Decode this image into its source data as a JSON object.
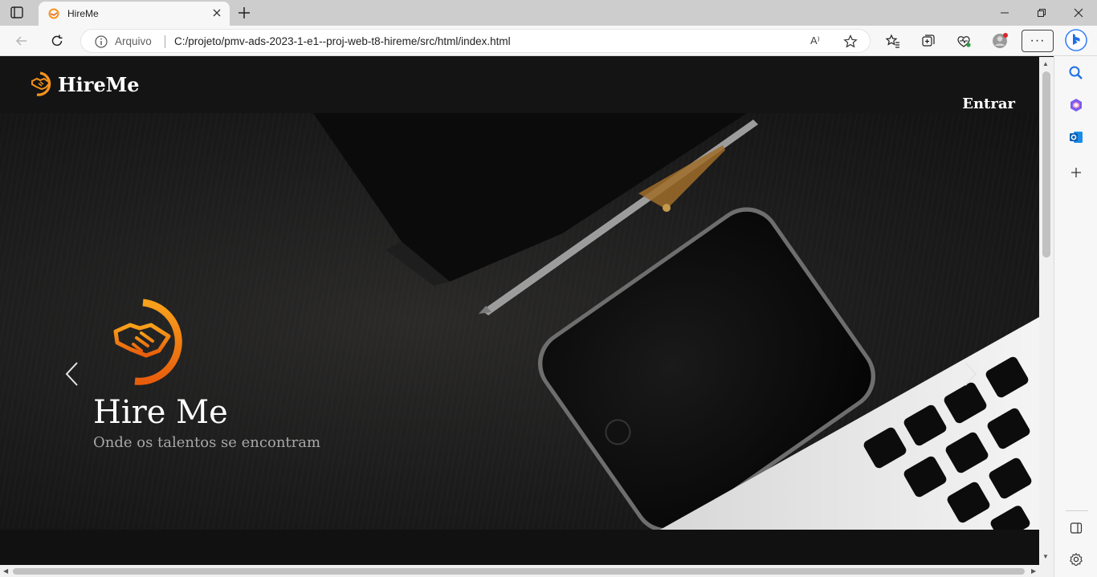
{
  "browser": {
    "tab": {
      "title": "HireMe"
    },
    "address": {
      "scheme_label": "Arquivo",
      "url": "C:/projeto/pmv-ads-2023-1-e1--proj-web-t8-hireme/src/html/index.html",
      "read_aloud": "A⁾"
    },
    "menu_label": "···"
  },
  "page": {
    "brand": "HireMe",
    "login_label": "Entrar",
    "hero": {
      "title": "Hire Me",
      "subtitle": "Onde os talentos se encontram"
    }
  },
  "colors": {
    "accent": "#f7931e",
    "accent_dark": "#e8650f",
    "page_bg": "#141414"
  }
}
